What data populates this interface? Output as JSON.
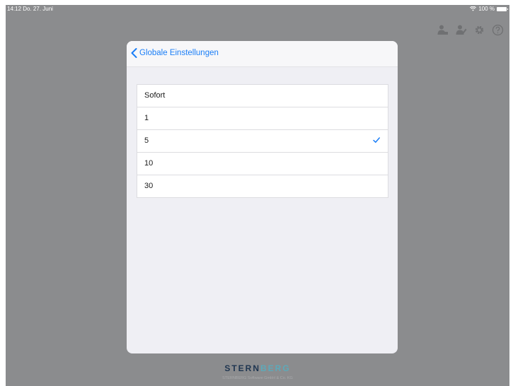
{
  "status_bar": {
    "time_date": "14:12  Do. 27. Juni",
    "battery": "100 %"
  },
  "top_icons": [
    "user-remove-icon",
    "user-edit-icon",
    "gear-icon",
    "help-icon"
  ],
  "modal": {
    "back_label": "Globale Einstellungen",
    "options": [
      {
        "label": "Sofort",
        "selected": false
      },
      {
        "label": "1",
        "selected": false
      },
      {
        "label": "5",
        "selected": true
      },
      {
        "label": "10",
        "selected": false
      },
      {
        "label": "30",
        "selected": false
      }
    ]
  },
  "footer": {
    "brand_main": "STERN",
    "brand_accent": "BERG",
    "company": "STERNBERG Software GmbH & Co. KG"
  },
  "colors": {
    "accent": "#1a7ef7",
    "overlay": "#8b8c8e",
    "brand_dark": "#1e3550",
    "brand_accent": "#5da9b9"
  }
}
